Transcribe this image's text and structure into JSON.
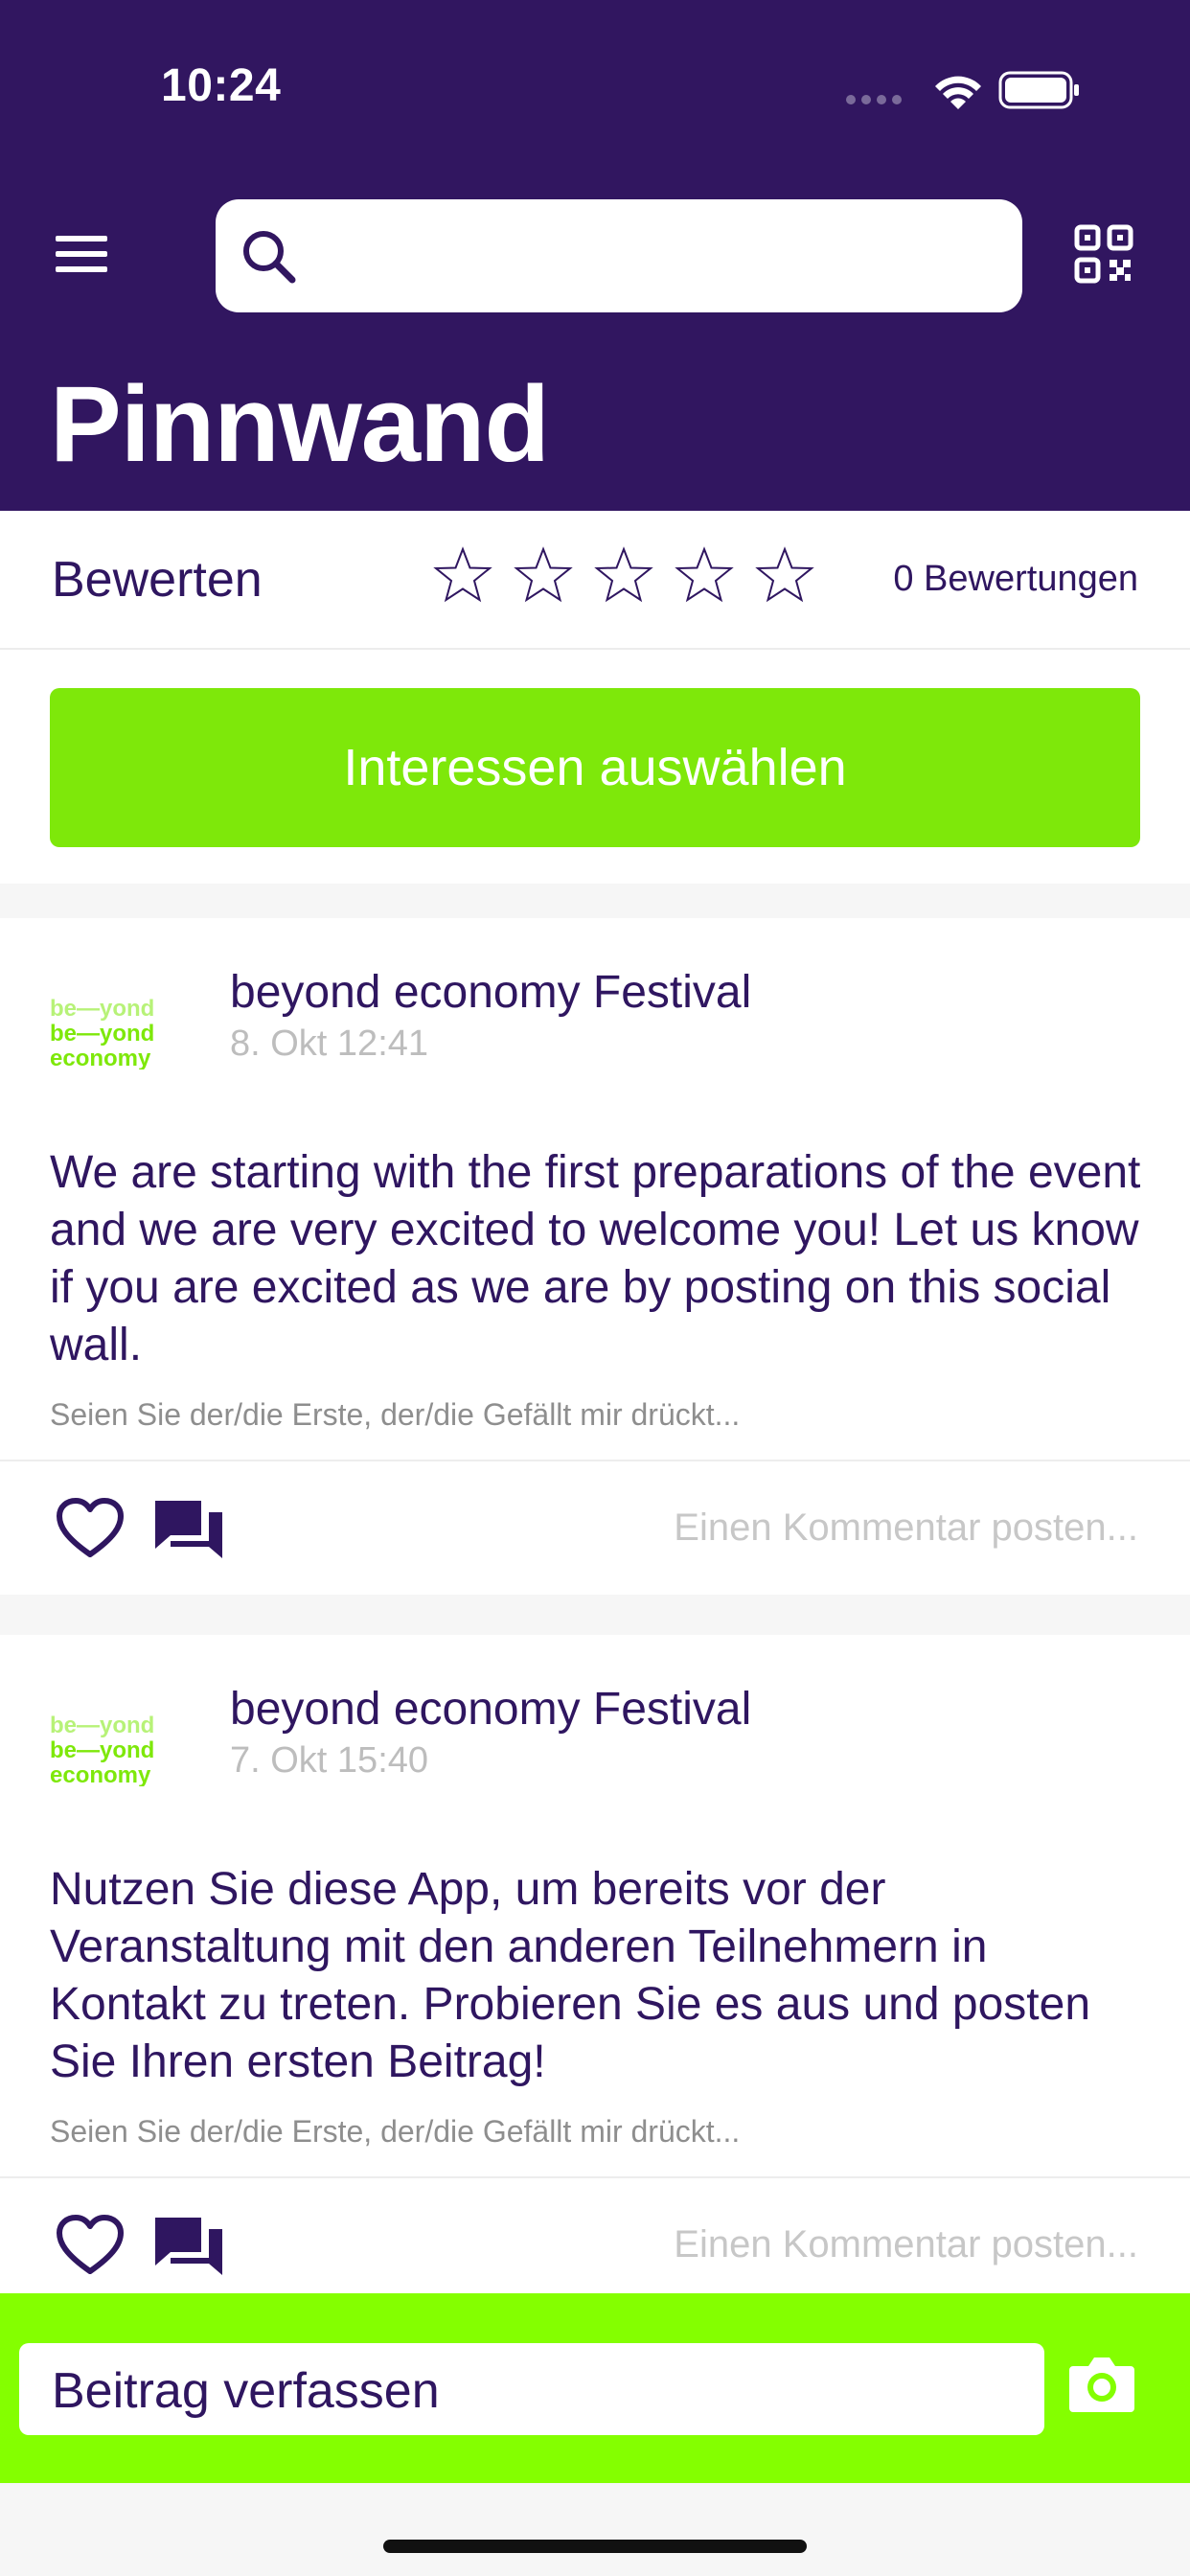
{
  "status_bar": {
    "time": "10:24"
  },
  "header": {
    "title": "Pinnwand",
    "search_placeholder": ""
  },
  "rating": {
    "label": "Bewerten",
    "stars_total": 5,
    "stars_filled": 0,
    "count_text": "0 Bewertungen"
  },
  "interests": {
    "button_label": "Interessen auswählen"
  },
  "posts": [
    {
      "author": "beyond economy Festival",
      "date": "8. Okt 12:41",
      "text": "We are starting with the first preparations of the event and we are very excited to welcome you! Let us know if you are excited as we are by posting on this social wall.",
      "like_hint": "Seien Sie der/die Erste, der/die Gefällt mir drückt...",
      "comment_placeholder": "Einen Kommentar posten..."
    },
    {
      "author": "beyond economy Festival",
      "date": "7. Okt 15:40",
      "text": "Nutzen Sie diese App, um bereits vor der Veranstaltung mit den anderen Teilnehmern in Kontakt zu treten. Probieren Sie es aus und posten Sie Ihren ersten Beitrag!",
      "like_hint": "Seien Sie der/die Erste, der/die Gefällt mir drückt...",
      "comment_placeholder": "Einen Kommentar posten..."
    }
  ],
  "compose": {
    "placeholder": "Beitrag verfassen"
  },
  "colors": {
    "header_bg": "#311660",
    "accent_green": "#84ff00",
    "button_green": "#7ee80a",
    "text_primary": "#2f1660"
  },
  "icons": [
    "menu-icon",
    "search-icon",
    "qr-code-icon",
    "star-icon",
    "heart-icon",
    "comment-icon",
    "camera-icon"
  ]
}
